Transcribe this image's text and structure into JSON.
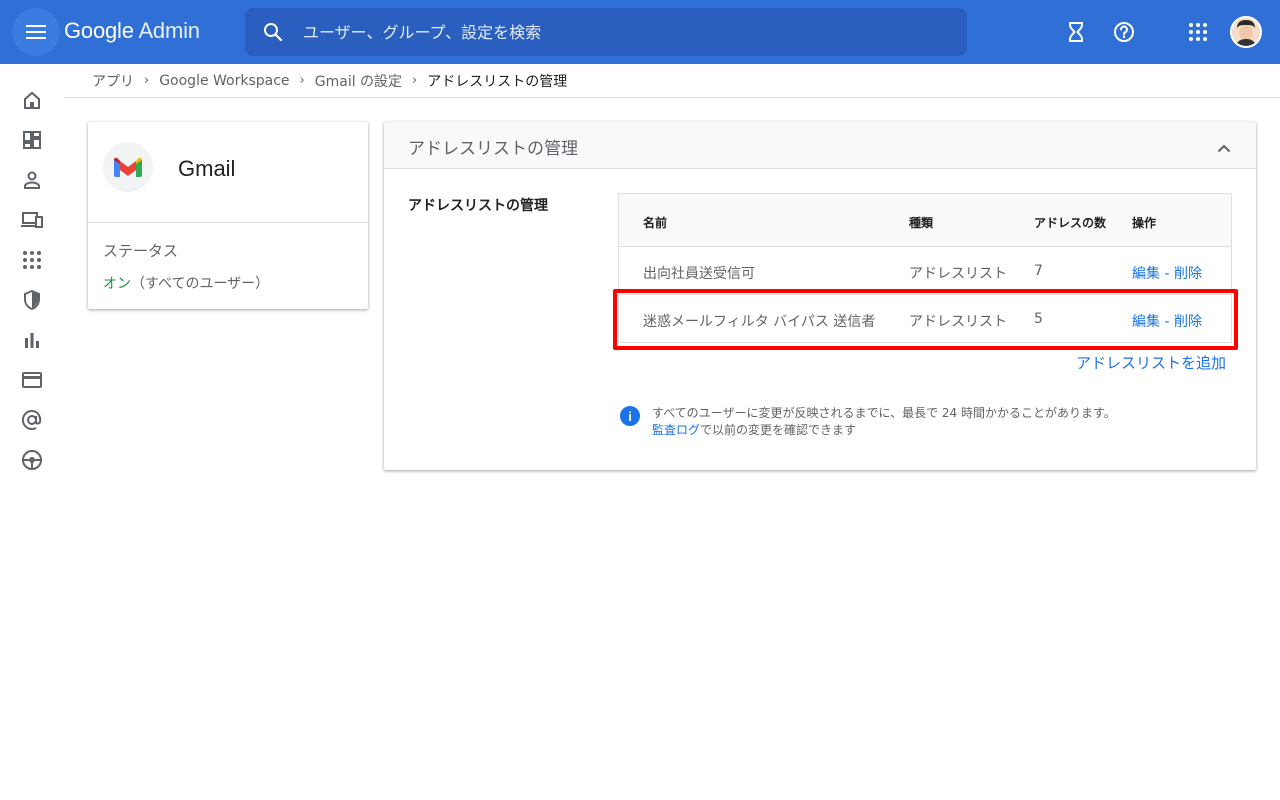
{
  "header": {
    "logo_google": "Google",
    "logo_admin": "Admin",
    "search_placeholder": "ユーザー、グループ、設定を検索"
  },
  "breadcrumb": [
    {
      "label": "アプリ"
    },
    {
      "label": "Google Workspace"
    },
    {
      "label": "Gmail の設定"
    },
    {
      "label": "アドレスリストの管理"
    }
  ],
  "app_card": {
    "name": "Gmail",
    "status_label": "ステータス",
    "status_on": "オン",
    "status_scope": "（すべてのユーザー）"
  },
  "panel": {
    "title": "アドレスリストの管理",
    "section_label": "アドレスリストの管理",
    "table": {
      "headers": [
        "名前",
        "種類",
        "アドレスの数",
        "操作"
      ],
      "rows": [
        {
          "name": "出向社員送受信可",
          "type": "アドレスリスト",
          "count": "7",
          "edit": "編集",
          "delete": "削除"
        },
        {
          "name": "迷惑メールフィルタ バイパス 送信者",
          "type": "アドレスリスト",
          "count": "5",
          "edit": "編集",
          "delete": "削除"
        }
      ],
      "action_separator": " - "
    },
    "add_link": "アドレスリストを追加",
    "info_line1": "すべてのユーザーに変更が反映されるまでに、最長で 24 時間かかることがあります。",
    "info_link": "監査ログ",
    "info_line2_rest": "で以前の変更を確認できます"
  },
  "colors": {
    "topbar": "#2f6fd6",
    "accent": "#1a73e8",
    "status_on": "#1e8e3e",
    "highlight": "#ff0000"
  },
  "icons": {
    "topbar": [
      "menu-icon",
      "search-icon",
      "hourglass-icon",
      "help-icon",
      "apps-grid-icon",
      "avatar"
    ],
    "rail": [
      "home-icon",
      "dashboard-icon",
      "user-icon",
      "devices-icon",
      "apps-icon",
      "security-shield-icon",
      "reports-icon",
      "billing-icon",
      "domains-at-icon",
      "account-icon"
    ]
  }
}
